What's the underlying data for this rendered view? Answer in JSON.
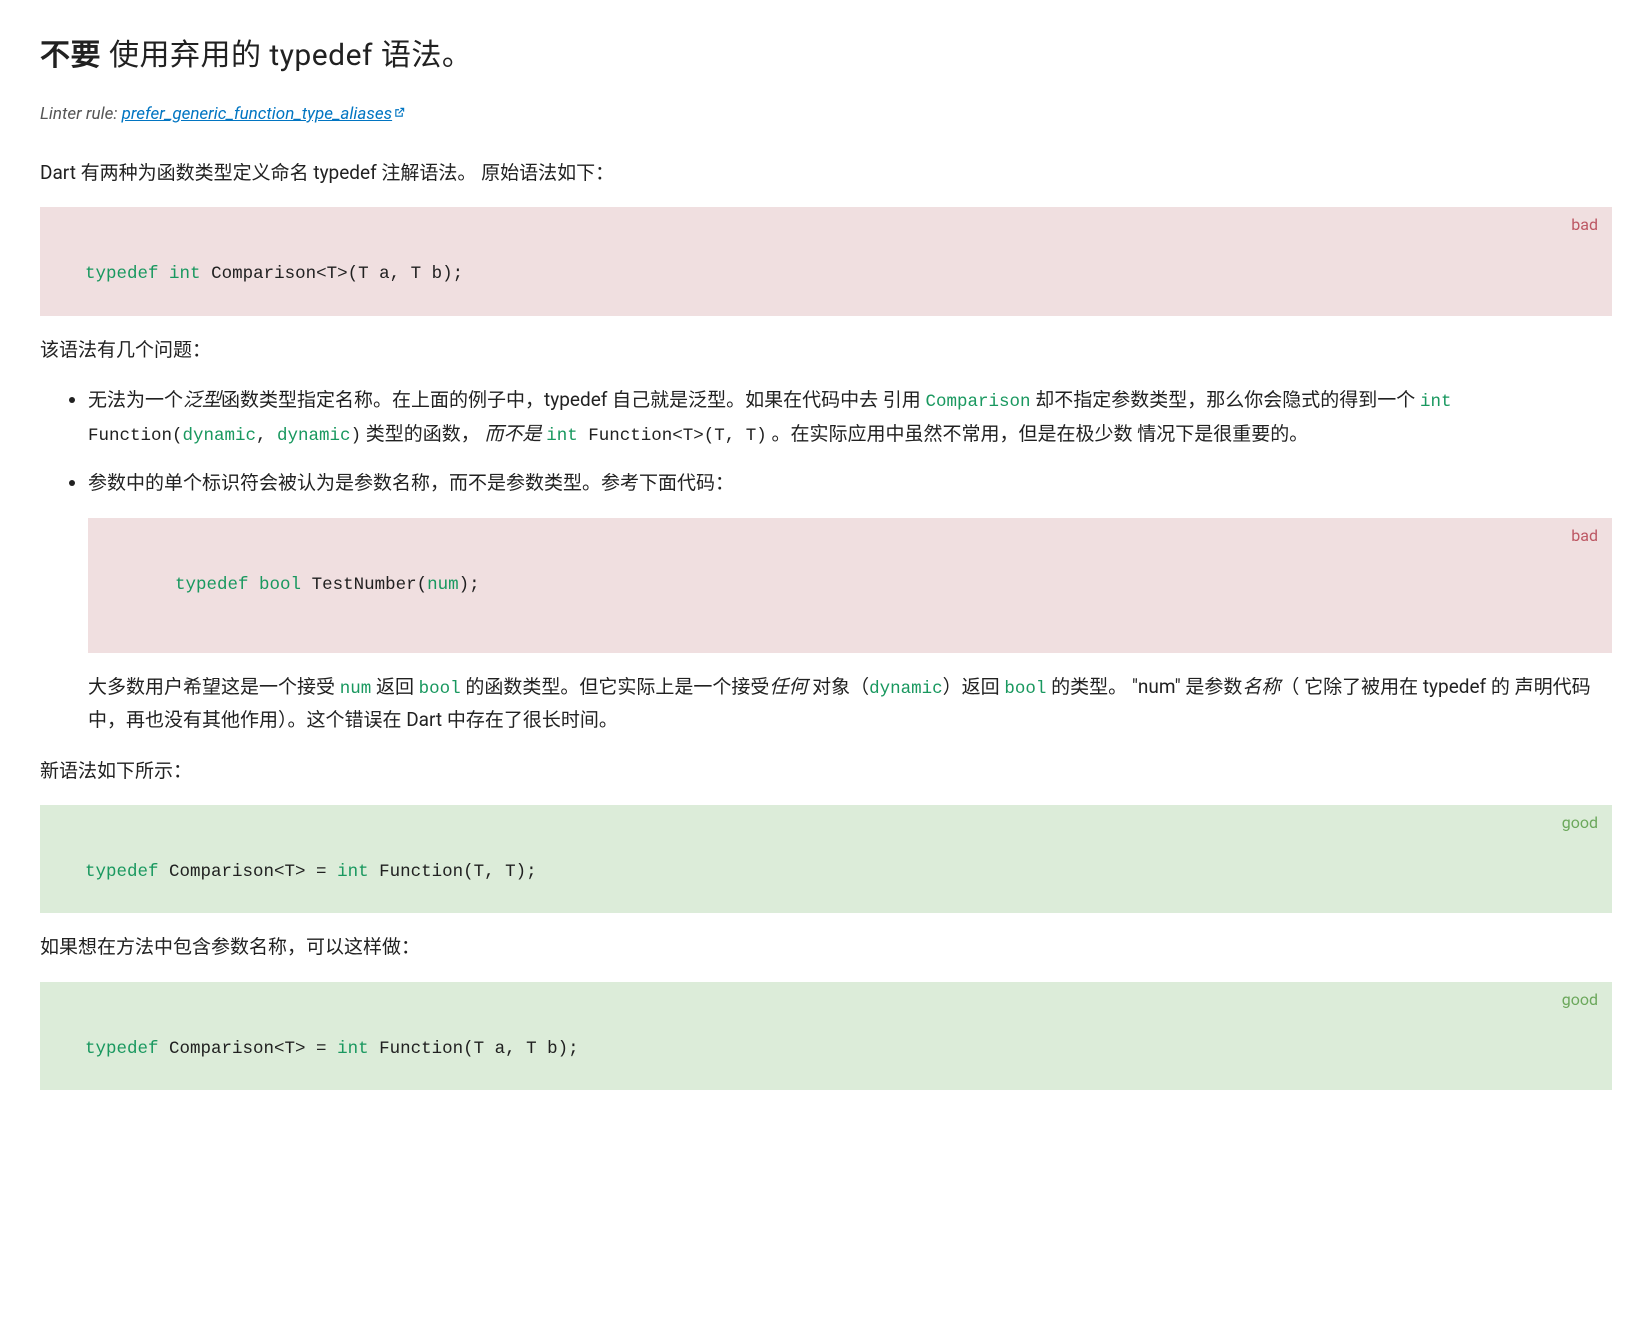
{
  "heading": {
    "strong": "不要",
    "rest": " 使用弃用的 typedef 语法。"
  },
  "linter": {
    "prefix": "Linter rule: ",
    "link_text": "prefer_generic_function_type_aliases"
  },
  "intro_para": "Dart 有两种为函数类型定义命名 typedef 注解语法。 原始语法如下：",
  "code1": {
    "label": "bad",
    "kw1": "typedef",
    "kw2": "int",
    "rest": " Comparison<T>(T a, T b);"
  },
  "para_problems": "该语法有几个问题：",
  "bullet1": {
    "t1": "无法为一个",
    "em1": "泛型",
    "t2": "函数类型指定名称。在上面的例子中，typedef 自己就是泛型。如果在代码中去 引用 ",
    "c1": "Comparison",
    "t3": " 却不指定参数类型，那么你会隐式的得到一个 ",
    "c2_kw": "int",
    "c2_rest": " Function(",
    "c2_kw2": "dynamic",
    "c2_rest2": ", ",
    "c2_kw3": "dynamic",
    "c2_rest3": ")",
    "t4": " 类型的函数， ",
    "em2": "而不是",
    "t5": " ",
    "c3_kw": "int",
    "c3_rest": " Function<T>(T, T)",
    "t6": " 。在实际应用中虽然不常用，但是在极少数 情况下是很重要的。"
  },
  "bullet2": {
    "lead": "参数中的单个标识符会被认为是参数名称，而不是参数类型。参考下面代码：",
    "code": {
      "label": "bad",
      "kw1": "typedef",
      "kw2": "bool",
      "rest1": " TestNumber(",
      "kw3": "num",
      "rest2": ");"
    },
    "after": {
      "t1": "大多数用户希望这是一个接受 ",
      "c1": "num",
      "t2": " 返回 ",
      "c2": "bool",
      "t3": " 的函数类型。但它实际上是一个接受",
      "em1": "任何",
      "t4": " 对象（",
      "c3": "dynamic",
      "t5": "）返回 ",
      "c4": "bool",
      "t6": " 的类型。 \"num\" 是参数",
      "em2": "名称",
      "t7": "（ 它除了被用在 typedef 的 声明代码中，再也没有其他作用）。这个错误在 Dart 中存在了很长时间。"
    }
  },
  "para_newsyntax": "新语法如下所示：",
  "code3": {
    "label": "good",
    "kw1": "typedef",
    "rest1": " Comparison<T> = ",
    "kw2": "int",
    "rest2": " Function(T, T);"
  },
  "para_paramnames": "如果想在方法中包含参数名称，可以这样做：",
  "code4": {
    "label": "good",
    "kw1": "typedef",
    "rest1": " Comparison<T> = ",
    "kw2": "int",
    "rest2": " Function(T a, T b);"
  }
}
